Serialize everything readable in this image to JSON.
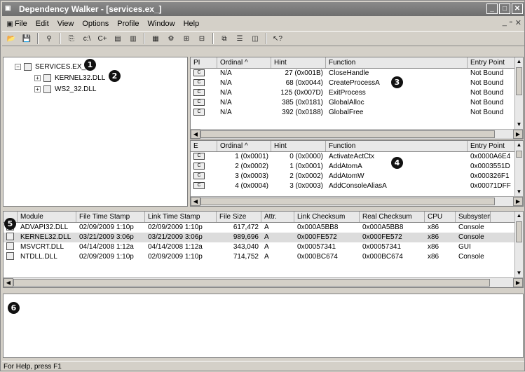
{
  "window": {
    "title": "Dependency Walker - [services.ex_]"
  },
  "menu": [
    "File",
    "Edit",
    "View",
    "Options",
    "Profile",
    "Window",
    "Help"
  ],
  "tree": {
    "root": "SERVICES.EX_",
    "children": [
      "KERNEL32.DLL",
      "WS2_32.DLL"
    ]
  },
  "parent_imports": {
    "headers": [
      "PI",
      "Ordinal ^",
      "Hint",
      "Function",
      "Entry Point"
    ],
    "rows": [
      [
        "N/A",
        "27 (0x001B)",
        "CloseHandle",
        "Not Bound"
      ],
      [
        "N/A",
        "68 (0x0044)",
        "CreateProcessA",
        "Not Bound"
      ],
      [
        "N/A",
        "125 (0x007D)",
        "ExitProcess",
        "Not Bound"
      ],
      [
        "N/A",
        "385 (0x0181)",
        "GlobalAlloc",
        "Not Bound"
      ],
      [
        "N/A",
        "392 (0x0188)",
        "GlobalFree",
        "Not Bound"
      ]
    ]
  },
  "exports": {
    "headers": [
      "E",
      "Ordinal ^",
      "Hint",
      "Function",
      "Entry Point"
    ],
    "rows": [
      [
        "1 (0x0001)",
        "0 (0x0000)",
        "ActivateActCtx",
        "0x0000A6E4"
      ],
      [
        "2 (0x0002)",
        "1 (0x0001)",
        "AddAtomA",
        "0x0003551D"
      ],
      [
        "3 (0x0003)",
        "2 (0x0002)",
        "AddAtomW",
        "0x000326F1"
      ],
      [
        "4 (0x0004)",
        "3 (0x0003)",
        "AddConsoleAliasA",
        "0x00071DFF"
      ]
    ]
  },
  "modules": {
    "headers": [
      "Module",
      "File Time Stamp",
      "Link Time Stamp",
      "File Size",
      "Attr.",
      "Link Checksum",
      "Real Checksum",
      "CPU",
      "Subsystem"
    ],
    "rows": [
      [
        "ADVAPI32.DLL",
        "02/09/2009  1:10p",
        "02/09/2009  1:10p",
        "617,472",
        "A",
        "0x000A5BB8",
        "0x000A5BB8",
        "x86",
        "Console"
      ],
      [
        "KERNEL32.DLL",
        "03/21/2009  3:06p",
        "03/21/2009  3:06p",
        "989,696",
        "A",
        "0x000FE572",
        "0x000FE572",
        "x86",
        "Console"
      ],
      [
        "MSVCRT.DLL",
        "04/14/2008  1:12a",
        "04/14/2008  1:12a",
        "343,040",
        "A",
        "0x00057341",
        "0x00057341",
        "x86",
        "GUI"
      ],
      [
        "NTDLL.DLL",
        "02/09/2009  1:10p",
        "02/09/2009  1:10p",
        "714,752",
        "A",
        "0x000BC674",
        "0x000BC674",
        "x86",
        "Console"
      ]
    ]
  },
  "callouts": [
    "1",
    "2",
    "3",
    "4",
    "5",
    "6"
  ],
  "status": "For Help, press F1"
}
